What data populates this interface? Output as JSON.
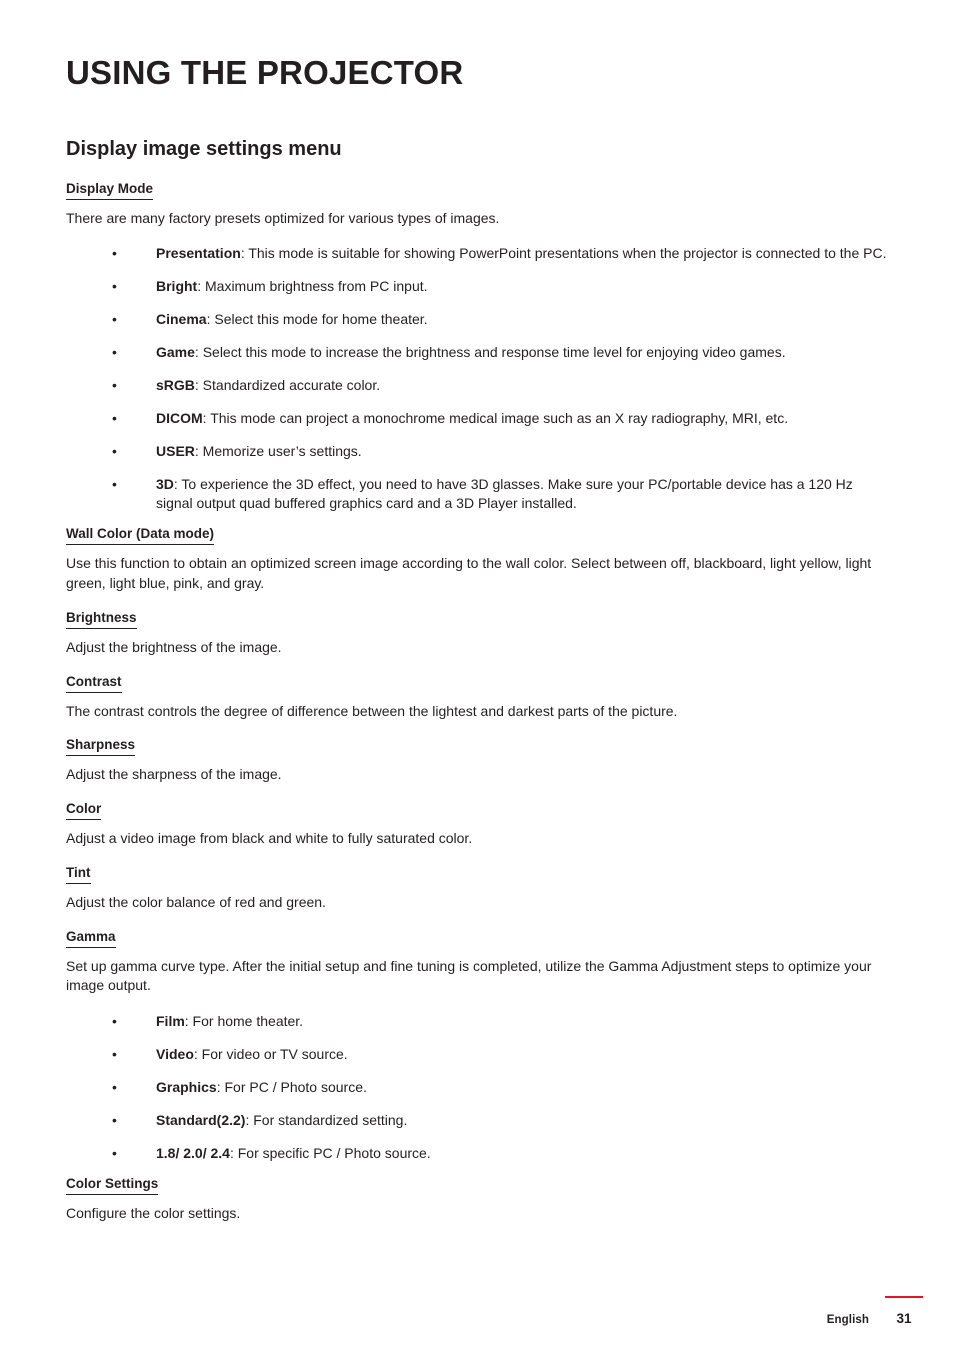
{
  "document": {
    "chapter_title": "USING THE PROJECTOR",
    "section_heading": "Display image settings menu"
  },
  "sections": {
    "display_mode": {
      "heading": "Display Mode",
      "intro": "There are many factory presets optimized for various types of images.",
      "bullet_char": "•",
      "items": [
        {
          "term": "Presentation",
          "desc": ": This mode is suitable for showing PowerPoint presentations when the projector is connected to the PC."
        },
        {
          "term": "Bright",
          "desc": ": Maximum brightness from PC input."
        },
        {
          "term": "Cinema",
          "desc": ": Select this mode for home theater."
        },
        {
          "term": "Game",
          "desc": ": Select this mode to increase the brightness and response time level for enjoying video games."
        },
        {
          "term": "sRGB",
          "desc": ": Standardized accurate color."
        },
        {
          "term": "DICOM",
          "desc": ": This mode can project a monochrome medical image such as an X ray radiography, MRI, etc."
        },
        {
          "term": "USER",
          "desc": ": Memorize user’s settings."
        },
        {
          "term": "3D",
          "desc": ": To experience the 3D effect, you need to have 3D glasses. Make sure your PC/portable device has a 120 Hz signal output quad buffered graphics card and a 3D Player installed."
        }
      ]
    },
    "wall_color": {
      "heading": "Wall Color (Data mode)",
      "body": "Use this function to obtain an optimized screen image according to the wall color. Select between off, blackboard, light yellow, light green, light blue, pink, and gray."
    },
    "brightness": {
      "heading": "Brightness",
      "body": "Adjust the brightness of the image."
    },
    "contrast": {
      "heading": "Contrast",
      "body": "The contrast controls the degree of difference between the lightest and darkest parts of the picture."
    },
    "sharpness": {
      "heading": "Sharpness",
      "body": "Adjust the sharpness of the image."
    },
    "color": {
      "heading": "Color",
      "body": "Adjust a video image from black and white to fully saturated color."
    },
    "tint": {
      "heading": "Tint",
      "body": "Adjust the color balance of red and green."
    },
    "gamma": {
      "heading": "Gamma",
      "body": "Set up gamma curve type. After the initial setup and fine tuning is completed, utilize the Gamma Adjustment steps to optimize your image output.",
      "bullet_char": "•",
      "items": [
        {
          "term": "Film",
          "desc": ": For home theater."
        },
        {
          "term": "Video",
          "desc": ": For video or TV source."
        },
        {
          "term": "Graphics",
          "desc": ": For PC / Photo source."
        },
        {
          "term": "Standard(2.2)",
          "desc": ": For standardized setting."
        },
        {
          "term": "1.8/ 2.0/ 2.4",
          "desc": ": For specific PC / Photo source."
        }
      ]
    },
    "color_settings": {
      "heading": "Color Settings",
      "body": "Configure the color settings."
    }
  },
  "footer": {
    "language": "English",
    "page_number": "31",
    "rule_color": "#e8112d"
  }
}
